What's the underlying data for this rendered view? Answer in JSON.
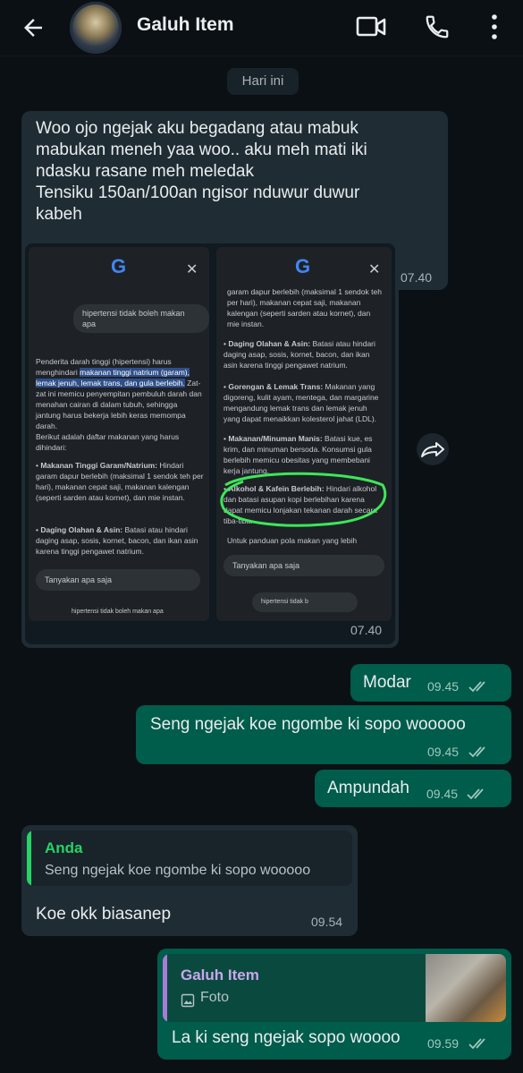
{
  "header": {
    "contact_name": "Galuh Item"
  },
  "chat": {
    "date_chip": "Hari ini",
    "messages": [
      {
        "text_lines": [
          "Woo ojo ngejak aku begadang atau mabuk",
          "mabukan meneh yaa woo.. aku meh mati iki",
          "ndasku rasane meh meledak",
          "Tensiku 150an/100an ngisor nduwur duwur",
          "kabeh"
        ],
        "time": "07.40"
      },
      {
        "image_time": "07.40",
        "left_shot": {
          "query": "hipertensi tidak boleh makan apa",
          "para1_a": "Penderita darah tinggi (hipertensi) harus menghindari ",
          "para1_hl": "makanan tinggi natrium (garam), lemak jenuh, lemak trans, dan gula berlebih.",
          "para1_b": " Zat-zat ini memicu penyempitan pembuluh darah dan menahan cairan di dalam tubuh, sehingga jantung harus bekerja lebih keras memompa darah.",
          "para2": "Berikut adalah daftar makanan yang harus dihindari:",
          "bullet1_title": "Makanan Tinggi Garam/Natrium:",
          "bullet1_body": " Hindari garam dapur berlebih (maksimal 1 sendok teh per hari), makanan cepat saji, makanan kalengan (seperti sarden atau kornet), dan mie instan.",
          "bullet2_title": "Daging Olahan & Asin:",
          "bullet2_body": " Batasi atau hindari daging asap, sosis, kornet, bacon, dan ikan asin karena tinggi pengawet natrium.",
          "ask": "Tanyakan apa saja",
          "bottom_query": "hipertensi tidak boleh makan apa"
        },
        "right_shot": {
          "top": "garam dapur berlebih (maksimal 1 sendok teh per hari), makanan cepat saji, makanan kalengan (seperti sarden atau kornet), dan mie instan.",
          "b1_title": "Daging Olahan & Asin:",
          "b1_body": " Batasi atau hindari daging asap, sosis, kornet, bacon, dan ikan asin karena tinggi pengawet natrium.",
          "b2_title": "Gorengan & Lemak Trans:",
          "b2_body": " Makanan yang digoreng, kulit ayam, mentega, dan margarine mengandung lemak trans dan lemak jenuh yang dapat menaikkan kolesterol jahat (LDL).",
          "b3_title": "Makanan/Minuman Manis:",
          "b3_body": " Batasi kue, es krim, dan minuman bersoda. Konsumsi gula berlebih memicu obesitas yang membebani kerja jantung.",
          "b4_title": "Alkohol & Kafein Berlebih:",
          "b4_body": " Hindari alkohol dan batasi asupan kopi berlebihan karena dapat memicu lonjakan tekanan darah secara tiba-tiba.",
          "footer": "Untuk panduan pola makan yang lebih",
          "ask": "Tanyakan apa saja",
          "bottom_query": "hipertensi tidak b"
        }
      },
      {
        "text": "Modar",
        "time": "09.45"
      },
      {
        "text": "Seng ngejak koe ngombe ki sopo wooooo",
        "time": "09.45"
      },
      {
        "text": "Ampundah",
        "time": "09.45"
      },
      {
        "quote_name": "Anda",
        "quote_text": "Seng ngejak koe ngombe ki sopo wooooo",
        "text": "Koe okk biasanep",
        "time": "09.54"
      },
      {
        "quote_name": "Galuh Item",
        "quote_text": "Foto",
        "text": "La ki seng ngejak sopo woooo",
        "time": "09.59"
      }
    ]
  },
  "colors": {
    "incoming_bubble": "#1f2c34",
    "outgoing_bubble": "#005c4b",
    "quote_green": "#25d366",
    "quote_purple": "#a87bd6"
  }
}
